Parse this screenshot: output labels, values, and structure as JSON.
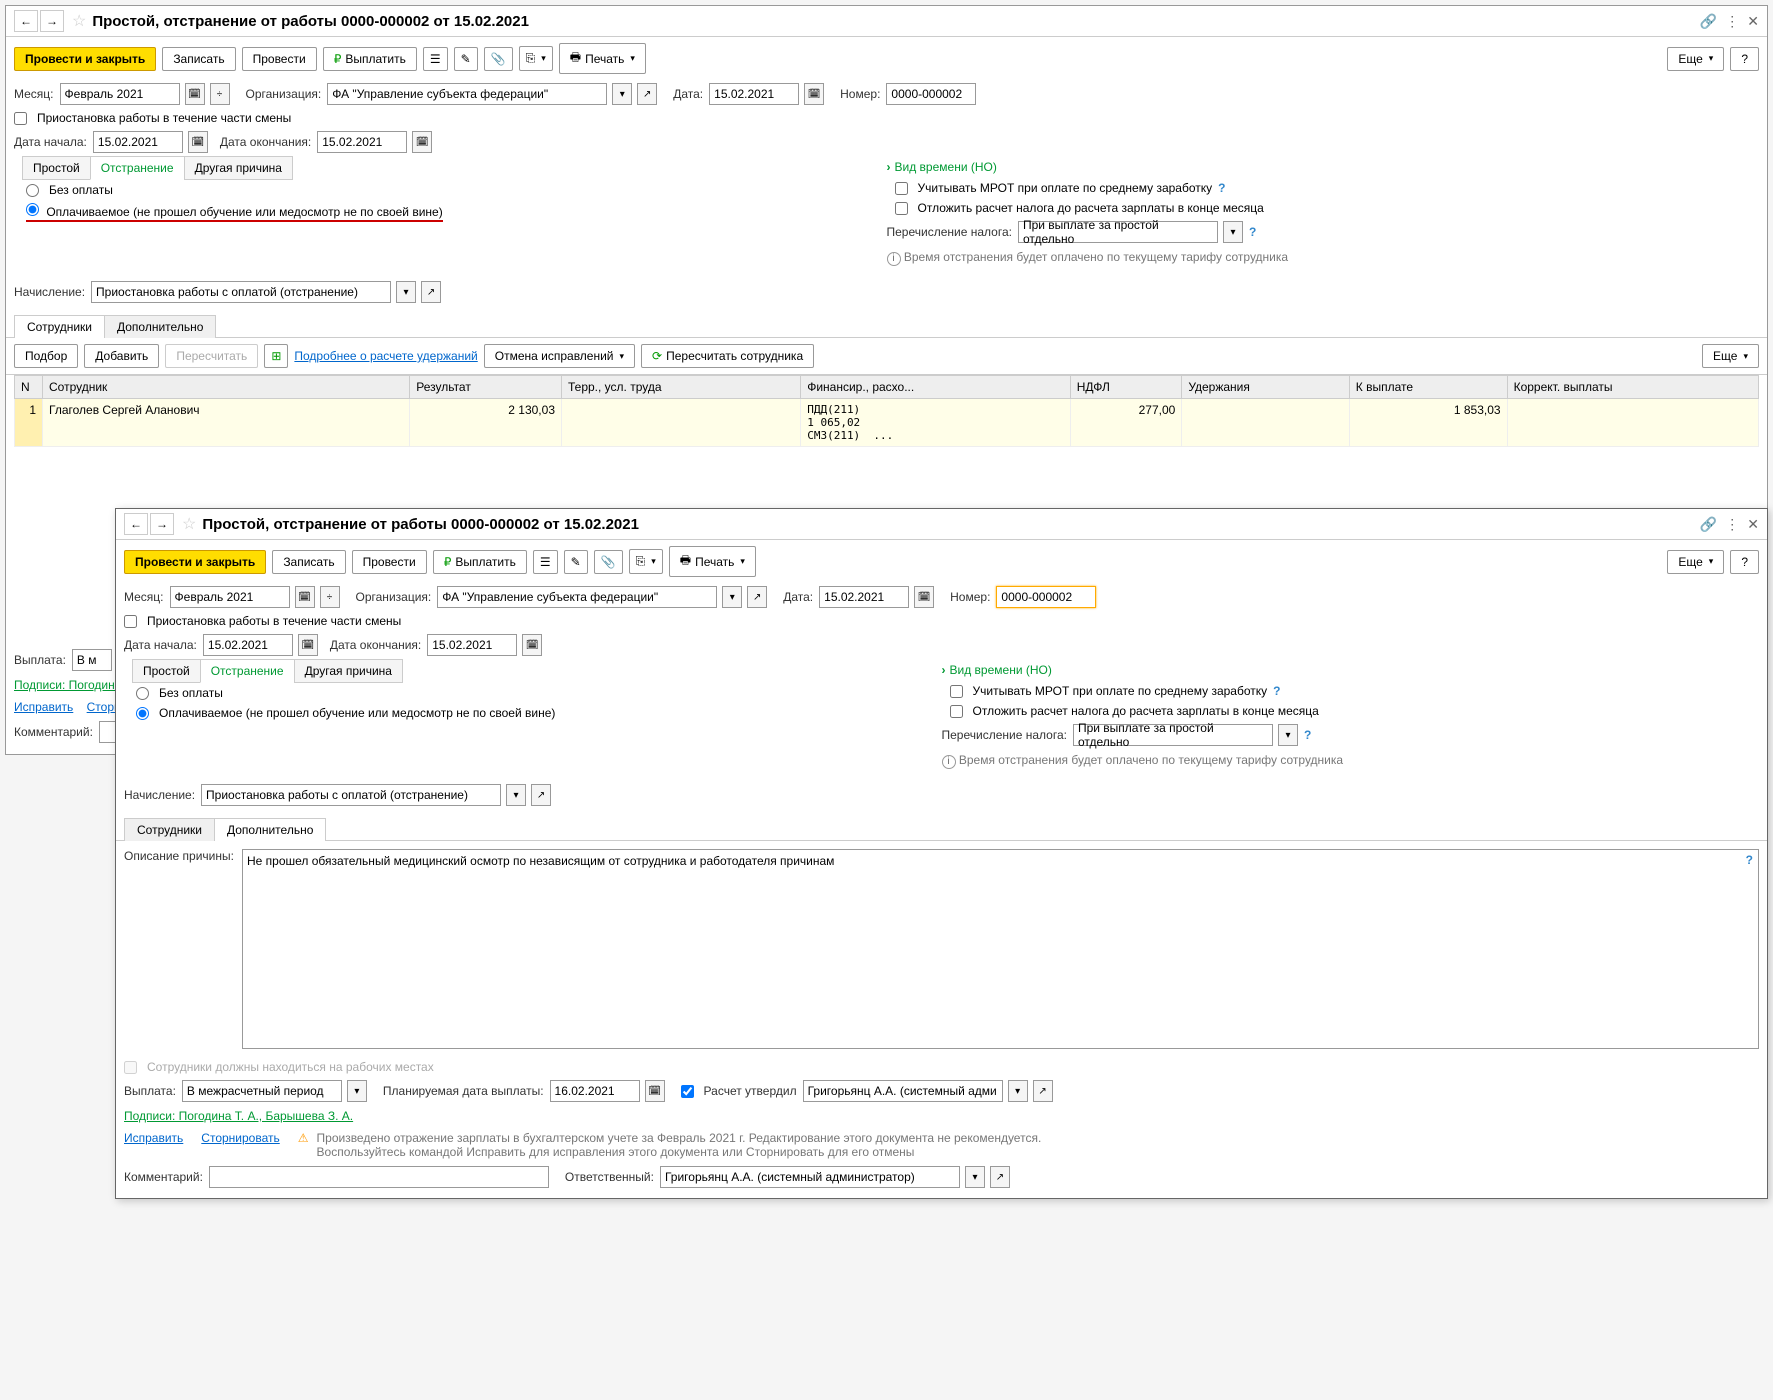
{
  "w1": {
    "title": "Простой, отстранение от работы 0000-000002 от 15.02.2021",
    "toolbar": {
      "post_close": "Провести и закрыть",
      "write": "Записать",
      "post": "Провести",
      "pay": "Выплатить",
      "print": "Печать",
      "more": "Еще",
      "help": "?"
    },
    "month_label": "Месяц:",
    "month_value": "Февраль 2021",
    "org_label": "Организация:",
    "org_value": "ФА \"Управление субъекта федерации\"",
    "date_label": "Дата:",
    "date_value": "15.02.2021",
    "number_label": "Номер:",
    "number_value": "0000-000002",
    "suspend_part": "Приостановка работы в течение части смены",
    "start_label": "Дата начала:",
    "start_value": "15.02.2021",
    "end_label": "Дата окончания:",
    "end_value": "15.02.2021",
    "tabs": {
      "simple": "Простой",
      "suspend": "Отстранение",
      "other": "Другая причина"
    },
    "radio_nopay": "Без оплаты",
    "radio_paid": "Оплачиваемое (не прошел обучение или медосмотр не по своей вине)",
    "time_type_link": "Вид времени (НО)",
    "mrot": "Учитывать МРОТ при оплате по среднему заработку",
    "defer_tax": "Отложить расчет налога до расчета зарплаты в конце месяца",
    "tax_transfer_label": "Перечисление налога:",
    "tax_transfer_value": "При выплате за простой отдельно",
    "info_text": "Время отстранения будет оплачено по текущему тарифу сотрудника",
    "accrual_label": "Начисление:",
    "accrual_value": "Приостановка работы с оплатой (отстранение)",
    "subtabs": {
      "employees": "Сотрудники",
      "additional": "Дополнительно"
    },
    "table_toolbar": {
      "select": "Подбор",
      "add": "Добавить",
      "recalc": "Пересчитать",
      "deductions": "Подробнее о расчете удержаний",
      "cancel_fix": "Отмена исправлений",
      "recalc_emp": "Пересчитать сотрудника",
      "more": "Еще"
    },
    "columns": {
      "n": "N",
      "employee": "Сотрудник",
      "result": "Результат",
      "terr": "Терр., усл. труда",
      "fin": "Финансир., расхо...",
      "ndfl": "НДФЛ",
      "ded": "Удержания",
      "topay": "К выплате",
      "corr": "Коррект. выплаты"
    },
    "row": {
      "n": "1",
      "employee": "Глаголев Сергей Аланович",
      "result": "2 130,03",
      "fin": "ПДД(211)\n1 065,02\nСМЗ(211)  ...",
      "ndfl": "277,00",
      "topay": "1 853,03"
    },
    "payout_label": "Выплата:",
    "payout_value": "В м",
    "signs": "Подписи: Погодина",
    "fix": "Исправить",
    "storno": "Сторн",
    "comment_label": "Комментарий:"
  },
  "w2": {
    "title": "Простой, отстранение от работы 0000-000002 от 15.02.2021",
    "number_value": "0000-000002",
    "desc_label": "Описание причины:",
    "desc_value": "Не прошел обязательный медицинский осмотр по независящим от сотрудника и работодателя причинам",
    "must_present": "Сотрудники должны находиться на рабочих местах",
    "payout_label": "Выплата:",
    "payout_value": "В межрасчетный период",
    "planned_label": "Планируемая дата выплаты:",
    "planned_value": "16.02.2021",
    "approved_label": "Расчет утвердил",
    "approved_value": "Григорьянц А.А. (системный адми",
    "signs": "Подписи: Погодина Т. А., Барышева З. А.",
    "fix": "Исправить",
    "storno": "Сторнировать",
    "warn1": "Произведено отражение зарплаты в бухгалтерском учете за Февраль 2021 г. Редактирование этого документа не рекомендуется.",
    "warn2": "Воспользуйтесь командой Исправить для исправления этого документа или Сторнировать для его отмены",
    "comment_label": "Комментарий:",
    "resp_label": "Ответственный:",
    "resp_value": "Григорьянц А.А. (системный администратор)"
  }
}
